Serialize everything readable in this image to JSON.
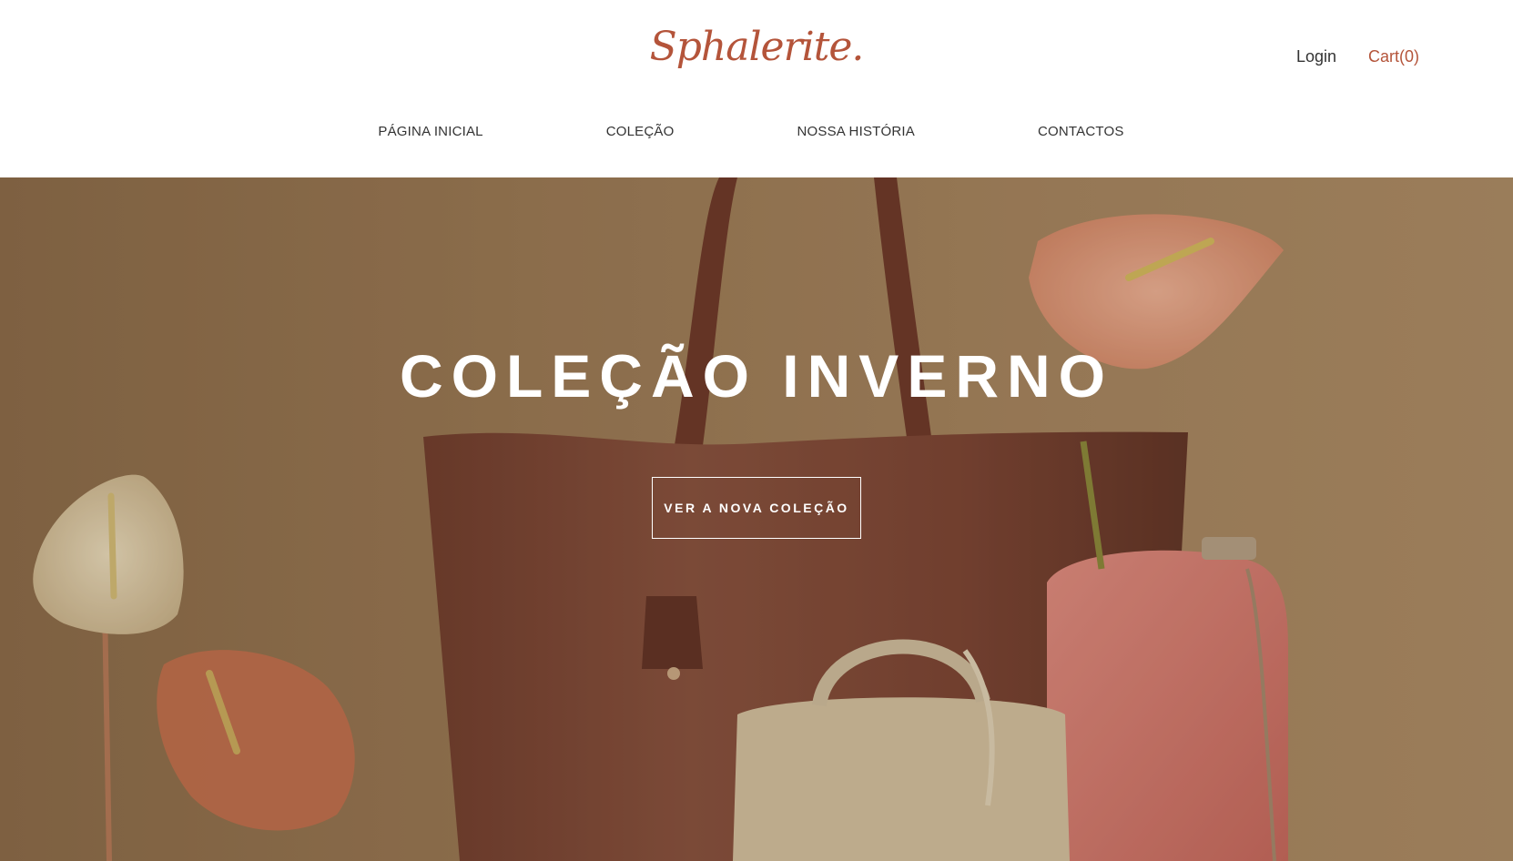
{
  "brand": {
    "logo_text": "Sphalerite.",
    "accent_color": "#b4543a"
  },
  "header": {
    "login_label": "Login",
    "cart_label": "Cart(0)"
  },
  "nav": {
    "items": [
      {
        "label": "PÁGINA INICIAL"
      },
      {
        "label": "COLEÇÃO"
      },
      {
        "label": "NOSSA HISTÓRIA"
      },
      {
        "label": "CONTACTOS"
      }
    ]
  },
  "hero": {
    "title": "COLEÇÃO INVERNO",
    "cta_label": "VER A NOVA COLEÇÃO",
    "background_color": "#9a7a56"
  }
}
